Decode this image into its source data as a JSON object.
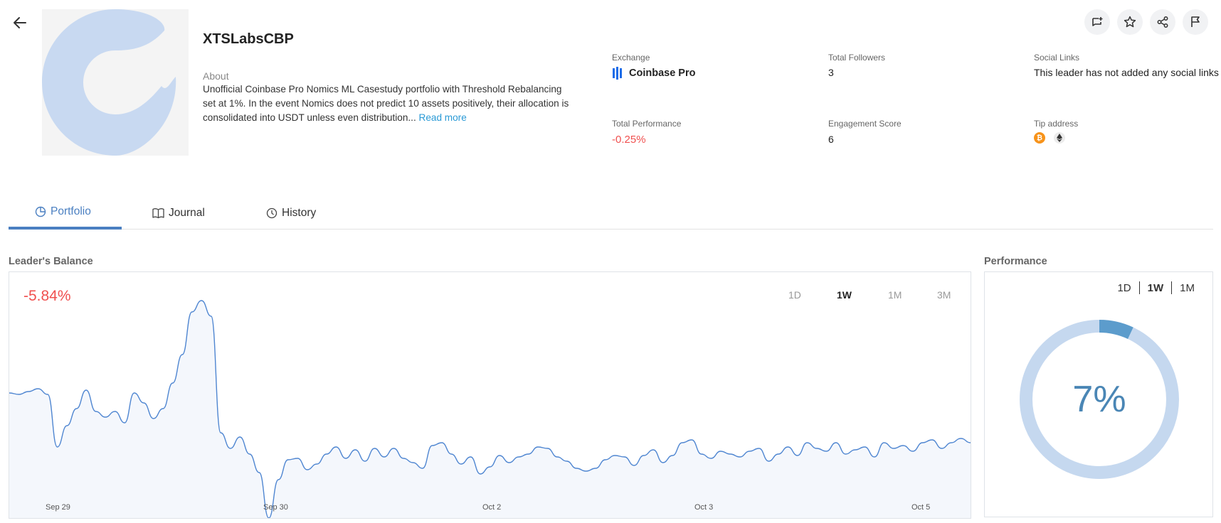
{
  "leader": {
    "name": "XTSLabsCBP",
    "about_label": "About",
    "about_text": "Unofficial Coinbase Pro Nomics ML Casestudy portfolio with Threshold Rebalancing set at 1%. In the event Nomics does not predict 10 assets positively, their allocation is consolidated into USDT unless even distribution...",
    "read_more": "Read more"
  },
  "stats": {
    "exchange_label": "Exchange",
    "exchange_value": "Coinbase Pro",
    "followers_label": "Total Followers",
    "followers_value": "3",
    "social_label": "Social Links",
    "social_value": "This leader has not added any social links",
    "performance_label": "Total Performance",
    "performance_value": "-0.25%",
    "engagement_label": "Engagement Score",
    "engagement_value": "6",
    "tip_label": "Tip address",
    "tip_icons": [
      "bitcoin-icon",
      "ethereum-icon"
    ]
  },
  "actions": [
    "add-to-list-icon",
    "star-icon",
    "share-icon",
    "flag-icon"
  ],
  "tabs": [
    {
      "label": "Portfolio",
      "icon": "pie-chart-icon",
      "active": true
    },
    {
      "label": "Journal",
      "icon": "book-icon",
      "active": false
    },
    {
      "label": "History",
      "icon": "clock-icon",
      "active": false
    }
  ],
  "balance": {
    "title": "Leader's Balance",
    "change": "-5.84%",
    "ranges": [
      "1D",
      "1W",
      "1M",
      "3M"
    ],
    "active_range": "1W"
  },
  "performance": {
    "title": "Performance",
    "ranges": [
      "1D",
      "1W",
      "1M"
    ],
    "active_range": "1W",
    "value_label": "7%",
    "fraction": 0.07
  },
  "colors": {
    "accent": "#4a7fc1",
    "negative": "#f0504f",
    "line": "#4f86d1",
    "area": "#f4f7fc",
    "donut_track": "#c5d8ef",
    "donut_fill": "#5c9ccc"
  },
  "chart_data": {
    "type": "area",
    "title": "",
    "x_tick_labels": [
      "Sep 29",
      "Sep 30",
      "Oct 2",
      "Oct 3",
      "Oct 5"
    ],
    "x": [
      0,
      1,
      2,
      3,
      4,
      5,
      6,
      7,
      8,
      9,
      10,
      11,
      12,
      13,
      14,
      15,
      16,
      17,
      18,
      19,
      20,
      21,
      22,
      23,
      24,
      25,
      26,
      27,
      28,
      29,
      30,
      31,
      32,
      33,
      34,
      35,
      36,
      37,
      38,
      39,
      40,
      41,
      42,
      43,
      44,
      45,
      46,
      47,
      48,
      49,
      50,
      51,
      52,
      53,
      54,
      55,
      56,
      57,
      58,
      59,
      60,
      61,
      62,
      63,
      64,
      65,
      66,
      67,
      68,
      69,
      70,
      71,
      72,
      73,
      74,
      75,
      76,
      77,
      78,
      79,
      80,
      81,
      82,
      83,
      84,
      85,
      86,
      87,
      88,
      89,
      90,
      91,
      92,
      93,
      94,
      95,
      96,
      97,
      98,
      99,
      100
    ],
    "series": [
      {
        "values": [
          100.3,
          100.2,
          100.4,
          100.6,
          100.2,
          96.5,
          98.0,
          99.2,
          100.5,
          99.0,
          98.6,
          99.0,
          98.2,
          100.3,
          99.6,
          98.5,
          99.2,
          101.0,
          103.0,
          106.0,
          106.8,
          105.7,
          97.5,
          96.4,
          97.2,
          96.0,
          94.7,
          91.5,
          94.2,
          95.6,
          95.7,
          94.9,
          95.3,
          96.0,
          96.5,
          95.7,
          96.3,
          95.5,
          96.4,
          95.8,
          96.4,
          95.7,
          95.4,
          95.0,
          96.6,
          96.8,
          96.0,
          95.3,
          95.8,
          94.6,
          95.1,
          95.9,
          95.4,
          95.8,
          96.0,
          96.5,
          96.4,
          95.8,
          95.5,
          95.0,
          94.8,
          95.0,
          95.6,
          95.9,
          95.8,
          95.2,
          95.9,
          96.3,
          95.4,
          95.9,
          96.8,
          97.0,
          96.0,
          95.7,
          96.2,
          96.0,
          95.8,
          96.2,
          96.4,
          95.5,
          96.0,
          96.5,
          95.9,
          96.8,
          96.4,
          96.2,
          96.8,
          96.0,
          96.3,
          96.5,
          95.8,
          96.8,
          96.4,
          96.6,
          96.2,
          96.8,
          97.0,
          96.4,
          96.8,
          97.1,
          96.8
        ]
      }
    ],
    "grid": false,
    "legend": "none"
  }
}
